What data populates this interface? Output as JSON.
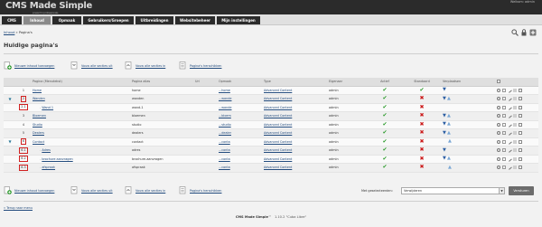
{
  "header": {
    "logo": "CMS Made Simple",
    "logo_sub": "power for professionals",
    "user_area": "Welkom: admin"
  },
  "topnav": {
    "tabs": [
      {
        "label": "CMS",
        "color": "#2b2b2b"
      },
      {
        "label": "Inhoud",
        "color": "#8a8a8a"
      },
      {
        "label": "Opmaak",
        "color": "#2b2b2b"
      },
      {
        "label": "Gebruikers/Groepen",
        "color": "#2b2b2b"
      },
      {
        "label": "Uitbreidingen",
        "color": "#2b2b2b"
      },
      {
        "label": "Websitebeheer",
        "color": "#2b2b2b"
      },
      {
        "label": "Mijn instellingen",
        "color": "#2b2b2b"
      }
    ]
  },
  "breadcrumb": {
    "root": "Inhoud",
    "sep": " » ",
    "current": "Pagina's"
  },
  "top_icons": [
    "search-icon",
    "lock-icon",
    "add-icon"
  ],
  "page_title": "Huidige pagina's",
  "actions": {
    "add": "Nieuwe inhoud toevoegen",
    "expand": "Vouw alle secties uit",
    "collapse": "Vouw alle secties in",
    "reorder": "Pagina's herschikken"
  },
  "table": {
    "headers": {
      "num": "",
      "title": "Pagina (Menutekst)",
      "alias": "Pagina alias",
      "url": "Url",
      "template": "Opmaak",
      "type": "Type",
      "owner": "Eigenaar",
      "active": "Actief",
      "default": "Standaard",
      "move": "Verplaatsen",
      "actions": ""
    },
    "rows": [
      {
        "tree": "",
        "num": "1",
        "num_hl": false,
        "indent": 0,
        "title": "Home",
        "alias": "home",
        "url": "",
        "template": "...home",
        "type": "Advanced Content",
        "owner": "admin",
        "active": true,
        "is_default": true,
        "move_down": true,
        "move_up": false
      },
      {
        "tree": "▼",
        "num": "2",
        "num_hl": true,
        "indent": 0,
        "title": "Wanden",
        "alias": "wanden",
        "url": "",
        "template": "...wande",
        "type": "Advanced Content",
        "owner": "admin",
        "active": true,
        "is_default": false,
        "move_down": true,
        "move_up": true
      },
      {
        "tree": "",
        "num": "2.1",
        "num_hl": true,
        "indent": 1,
        "title": "Wand 1",
        "alias": "wand-1",
        "url": "",
        "template": "...wande",
        "type": "Advanced Content",
        "owner": "admin",
        "active": true,
        "is_default": false,
        "move_down": false,
        "move_up": false
      },
      {
        "tree": "",
        "num": "3",
        "num_hl": false,
        "indent": 0,
        "title": "Bloemen",
        "alias": "bloemen",
        "url": "",
        "template": "...bloem",
        "type": "Advanced Content",
        "owner": "admin",
        "active": true,
        "is_default": false,
        "move_down": true,
        "move_up": true
      },
      {
        "tree": "",
        "num": "4",
        "num_hl": false,
        "indent": 0,
        "title": "Studio",
        "alias": "studio",
        "url": "",
        "template": "...studio",
        "type": "Advanced Content",
        "owner": "admin",
        "active": true,
        "is_default": false,
        "move_down": true,
        "move_up": true
      },
      {
        "tree": "",
        "num": "5",
        "num_hl": false,
        "indent": 0,
        "title": "Dealers",
        "alias": "dealers",
        "url": "",
        "template": "...dealer",
        "type": "Advanced Content",
        "owner": "admin",
        "active": true,
        "is_default": false,
        "move_down": true,
        "move_up": true
      },
      {
        "tree": "▼",
        "num": "6",
        "num_hl": true,
        "indent": 0,
        "title": "Contact",
        "alias": "contact",
        "url": "",
        "template": "...conta",
        "type": "Advanced Content",
        "owner": "admin",
        "active": true,
        "is_default": false,
        "move_down": false,
        "move_up": true
      },
      {
        "tree": "",
        "num": "6.1",
        "num_hl": true,
        "indent": 1,
        "title": "Adres",
        "alias": "adres",
        "url": "",
        "template": "...conta",
        "type": "Advanced Content",
        "owner": "admin",
        "active": true,
        "is_default": false,
        "move_down": true,
        "move_up": false
      },
      {
        "tree": "",
        "num": "6.2",
        "num_hl": true,
        "indent": 1,
        "title": "brochure aanvragen",
        "alias": "brochure-aanvragen",
        "url": "",
        "template": "...conta",
        "type": "Advanced Content",
        "owner": "admin",
        "active": true,
        "is_default": false,
        "move_down": true,
        "move_up": true
      },
      {
        "tree": "",
        "num": "6.3",
        "num_hl": true,
        "indent": 1,
        "title": "afspraak",
        "alias": "afspraak",
        "url": "",
        "template": "...conta",
        "type": "Advanced Content",
        "owner": "admin",
        "active": true,
        "is_default": false,
        "move_down": false,
        "move_up": true
      }
    ]
  },
  "bulk": {
    "label": "Met geselecteerden:",
    "selected": "Verwijderen",
    "submit": "Versturen"
  },
  "back_link": "« Terug naar menu",
  "footer": {
    "brand": "CMS Made Simple",
    "tm": "™",
    "version": "1.10.2",
    "codename": "\"Cuba Libre\""
  },
  "colors": {
    "accent_link": "#234c7e",
    "active_check": "#2a9a2a",
    "default_x": "#cc1a1a",
    "highlight_border": "#d02020"
  }
}
